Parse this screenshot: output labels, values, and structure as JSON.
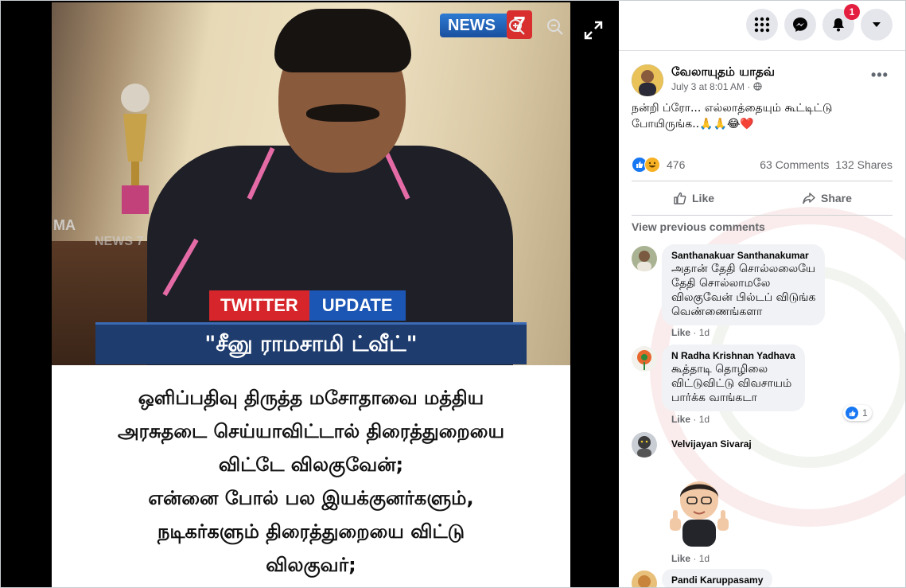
{
  "viewer": {
    "close_icon": "close-icon",
    "logo_letter": "f",
    "news_logo_text": "NEWS",
    "news_logo_number": "7",
    "ghost_text_ma": "MA",
    "ghost_text_news": "NEWS 7",
    "tag_left": "TWITTER",
    "tag_right": "UPDATE",
    "banner": "\"சீனு ராமசாமி ட்வீட்\"",
    "caption_lines": [
      "ஒளிப்பதிவு திருத்த மசோதாவை மத்திய",
      "அரசுதடை செய்யாவிட்டால் திரைத்துறையை",
      "விட்டே விலகுவேன்;",
      "என்னை போல் பல இயக்குனர்களும்,",
      "நடிகர்களும் திரைத்துறையை விட்டு",
      "விலகுவர்;"
    ]
  },
  "topbar": {
    "notifications_count": "1"
  },
  "post": {
    "author": "வேலாயுதம் யாதவ்",
    "timestamp": "July 3 at 8:01 AM",
    "privacy_sep": "·",
    "more_label": "•••",
    "text": "நன்றி ப்ரோ... எல்லாத்தையும் கூட்டிட்டு போயிருங்க..🙏🙏😂❤️",
    "reaction_count": "476",
    "comments_count": "63 Comments",
    "shares_count": "132 Shares",
    "like_label": "Like",
    "share_label": "Share",
    "view_previous": "View previous comments"
  },
  "comments": [
    {
      "name": "Santhanakuar Santhanakumar",
      "text": "அதான் தேதி சொல்லலையே\nதேதி சொல்லாமலே\nவிலகுவேன் பில்டப் விடுங்க\nவெண்ணைங்களா",
      "like": "Like",
      "time": "1d"
    },
    {
      "name": "N Radha Krishnan Yadhava",
      "text": "கூத்தாடி தொழிலை\nவிட்டுவிட்டு விவசாயம்\nபார்க்க வாங்கடா",
      "like": "Like",
      "time": "1d",
      "reactions": "1"
    },
    {
      "name": "Velvijayan Sivaraj",
      "like": "Like",
      "time": "1d"
    },
    {
      "name": "Pandi Karuppasamy"
    }
  ],
  "colors": {
    "facebook_blue": "#1877f2",
    "badge_red": "#e41e3f",
    "banner_navy": "#1e3c6e",
    "tag_red": "#d7262b",
    "tag_blue": "#1c56b4"
  }
}
